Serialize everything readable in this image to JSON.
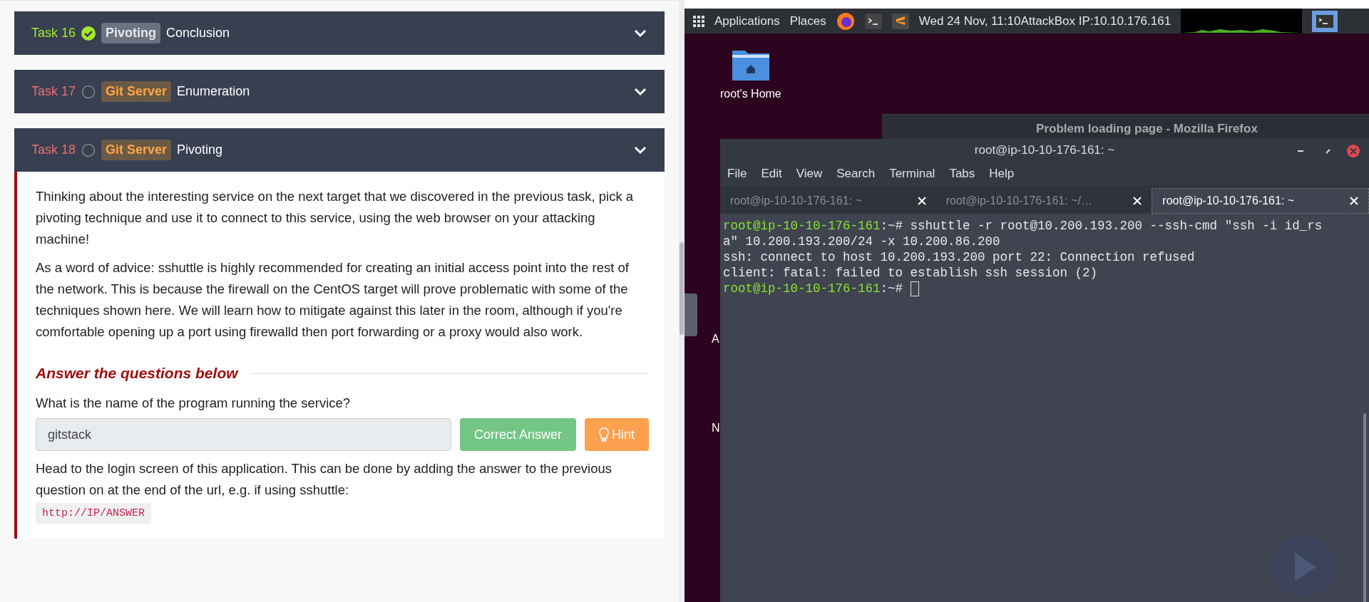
{
  "tasks": [
    {
      "number": "Task 16",
      "completed": true,
      "tag": {
        "label": "Pivoting",
        "kind": "room"
      },
      "title": "Conclusion",
      "expanded": false
    },
    {
      "number": "Task 17",
      "completed": false,
      "tag": {
        "label": "Git Server",
        "kind": "network"
      },
      "title": "Enumeration",
      "expanded": false
    },
    {
      "number": "Task 18",
      "completed": false,
      "tag": {
        "label": "Git Server",
        "kind": "network"
      },
      "title": "Pivoting",
      "expanded": true,
      "paragraphs": [
        "Thinking about the interesting service on the next target that we discovered in the previous task, pick a pivoting technique and use it to connect to this service, using the web browser on your attacking machine!",
        "As a word of advice: sshuttle is highly recommended for creating an initial access point into the rest of the network. This is because the firewall on the CentOS target will prove problematic with some of the techniques shown here. We will learn how to mitigate against this later in the room, although if you're comfortable opening up a port using firewalld then port forwarding or a proxy would also work."
      ],
      "questions_heading": "Answer the questions below",
      "questions": [
        {
          "text": "What is the name of the program running the service?",
          "answer": "gitstack",
          "correct": true,
          "submit": "Correct Answer",
          "hint": "Hint"
        }
      ],
      "instruction": "Head to the login screen of this application. This can be done by adding the answer to the previous question on at the end of the url, e.g. if using sshuttle:",
      "code": "http://IP/ANSWER"
    }
  ],
  "desktop": {
    "panel": {
      "menus": [
        "Applications",
        "Places"
      ],
      "clock": "Wed 24 Nov, 11:10",
      "ip": "AttackBox IP:10.10.176.161"
    },
    "icons": [
      {
        "label": "root's Home"
      }
    ],
    "cut_labels": [
      "A",
      "N"
    ],
    "firefox": {
      "title": "Problem loading page - Mozilla Firefox"
    },
    "terminal": {
      "title": "root@ip-10-10-176-161: ~",
      "menu": [
        "File",
        "Edit",
        "View",
        "Search",
        "Terminal",
        "Tabs",
        "Help"
      ],
      "tabs": [
        {
          "label": "root@ip-10-10-176-161: ~",
          "selected": false
        },
        {
          "label": "root@ip-10-10-176-161: ~/…",
          "selected": false
        },
        {
          "label": "root@ip-10-10-176-161: ~",
          "selected": true
        }
      ],
      "lines": [
        {
          "prompt": "root@ip-10-10-176-161",
          "text": ":~# sshuttle -r root@10.200.193.200 --ssh-cmd \"ssh -i id_rs",
          "cursor": false
        },
        {
          "text": "a\" 10.200.193.200/24 -x 10.200.86.200",
          "cursor": false
        },
        {
          "text": "ssh: connect to host 10.200.193.200 port 22: Connection refused",
          "cursor": false
        },
        {
          "text": "client: fatal: failed to establish ssh session (2)",
          "cursor": false
        },
        {
          "prompt": "root@ip-10-10-176-161",
          "text": ":~# ",
          "cursor": true
        }
      ]
    }
  }
}
